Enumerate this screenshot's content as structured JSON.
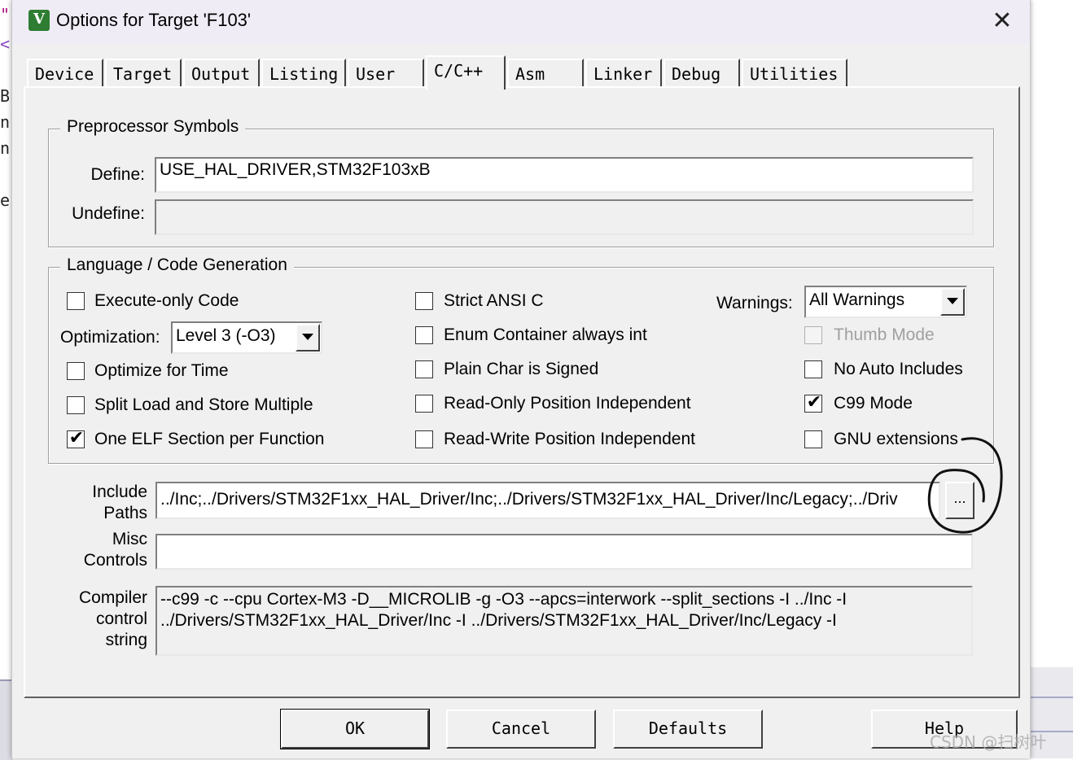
{
  "background": {
    "left_chars": [
      "\"",
      "<",
      "B",
      "n",
      "n",
      "e"
    ]
  },
  "dialog": {
    "title": "Options for Target 'F103'",
    "app_icon": "uvision-icon",
    "close_glyph": "✕"
  },
  "tabs": [
    {
      "label": "Device"
    },
    {
      "label": "Target"
    },
    {
      "label": "Output"
    },
    {
      "label": "Listing"
    },
    {
      "label": "User"
    },
    {
      "label": "C/C++",
      "active": true
    },
    {
      "label": "Asm"
    },
    {
      "label": "Linker"
    },
    {
      "label": "Debug"
    },
    {
      "label": "Utilities"
    }
  ],
  "preprocessor": {
    "legend": "Preprocessor Symbols",
    "define_label": "Define:",
    "define_value": "USE_HAL_DRIVER,STM32F103xB",
    "undefine_label": "Undefine:",
    "undefine_value": ""
  },
  "language": {
    "legend": "Language / Code Generation",
    "execute_only": {
      "label": "Execute-only Code",
      "checked": false
    },
    "optimization_label": "Optimization:",
    "optimization_value": "Level 3 (-O3)",
    "optimize_time": {
      "label": "Optimize for Time",
      "checked": false
    },
    "split_load": {
      "label": "Split Load and Store Multiple",
      "checked": false
    },
    "one_elf": {
      "label": "One ELF Section per Function",
      "checked": true
    },
    "strict_ansi": {
      "label": "Strict ANSI C",
      "checked": false
    },
    "enum_container": {
      "label": "Enum Container always int",
      "checked": false
    },
    "plain_char": {
      "label": "Plain Char is Signed",
      "checked": false
    },
    "ro_pos_indep": {
      "label": "Read-Only Position Independent",
      "checked": false
    },
    "rw_pos_indep": {
      "label": "Read-Write Position Independent",
      "checked": false
    },
    "warnings_label": "Warnings:",
    "warnings_value": "All Warnings",
    "thumb_mode": {
      "label": "Thumb Mode",
      "checked": false,
      "disabled": true
    },
    "no_auto_includes": {
      "label": "No Auto Includes",
      "checked": false
    },
    "c99_mode": {
      "label": "C99 Mode",
      "checked": true
    },
    "gnu_extensions": {
      "label": "GNU extensions",
      "checked": false
    },
    "check_glyph": "✔"
  },
  "paths": {
    "include_label_1": "Include",
    "include_label_2": "Paths",
    "include_value": "../Inc;../Drivers/STM32F1xx_HAL_Driver/Inc;../Drivers/STM32F1xx_HAL_Driver/Inc/Legacy;../Driv",
    "browse_label": "...",
    "misc_label_1": "Misc",
    "misc_label_2": "Controls",
    "misc_value": "",
    "compiler_label_1": "Compiler",
    "compiler_label_2": "control",
    "compiler_label_3": "string",
    "compiler_value": "--c99 -c --cpu Cortex-M3 -D__MICROLIB -g -O3 --apcs=interwork --split_sections -I ../Inc -I ../Drivers/STM32F1xx_HAL_Driver/Inc -I ../Drivers/STM32F1xx_HAL_Driver/Inc/Legacy -I"
  },
  "buttons": {
    "ok": "OK",
    "cancel": "Cancel",
    "defaults": "Defaults",
    "help": "Help"
  },
  "watermark": "CSDN @扫树叶"
}
